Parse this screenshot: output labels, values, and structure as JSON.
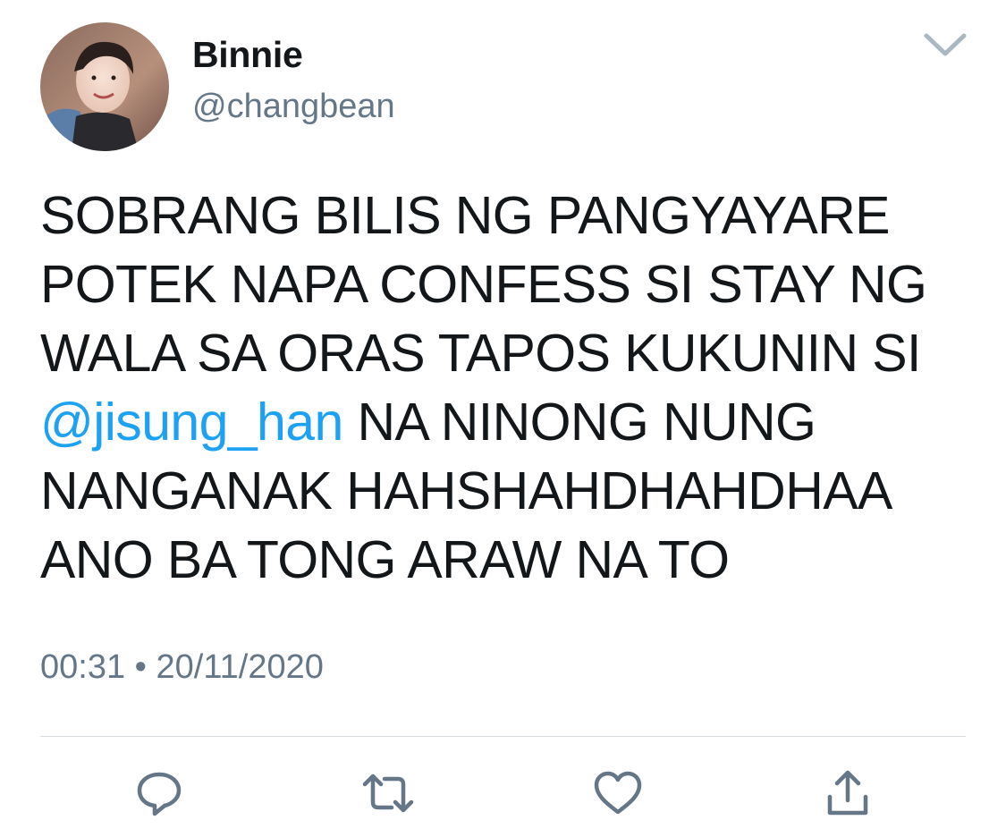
{
  "tweet": {
    "author": {
      "display_name": "Binnie",
      "handle": "@changbean"
    },
    "text_lines": [
      {
        "text": "SOBRANG BILIS NG PANGYAYARE"
      },
      {
        "text": "POTEK NAPA CONFESS SI STAY NG"
      },
      {
        "text": "WALA SA ORAS TAPOS KUKUNIN SI"
      },
      {
        "mention": "@jisung_han",
        "text": " NA NINONG NUNG"
      },
      {
        "text": "NANGANAK HAHSHAHDHAHDHAA"
      },
      {
        "text": "ANO BA TONG ARAW NA TO"
      }
    ],
    "time": "00:31",
    "separator": "•",
    "date": "20/11/2020"
  },
  "actions": [
    {
      "name": "reply",
      "icon": "reply-icon"
    },
    {
      "name": "retweet",
      "icon": "retweet-icon"
    },
    {
      "name": "like",
      "icon": "heart-icon"
    },
    {
      "name": "share",
      "icon": "share-icon"
    }
  ],
  "colors": {
    "text": "#14171a",
    "secondary": "#657786",
    "link": "#1da1f2",
    "icon": "#657786",
    "divider": "#d6dbdf"
  }
}
